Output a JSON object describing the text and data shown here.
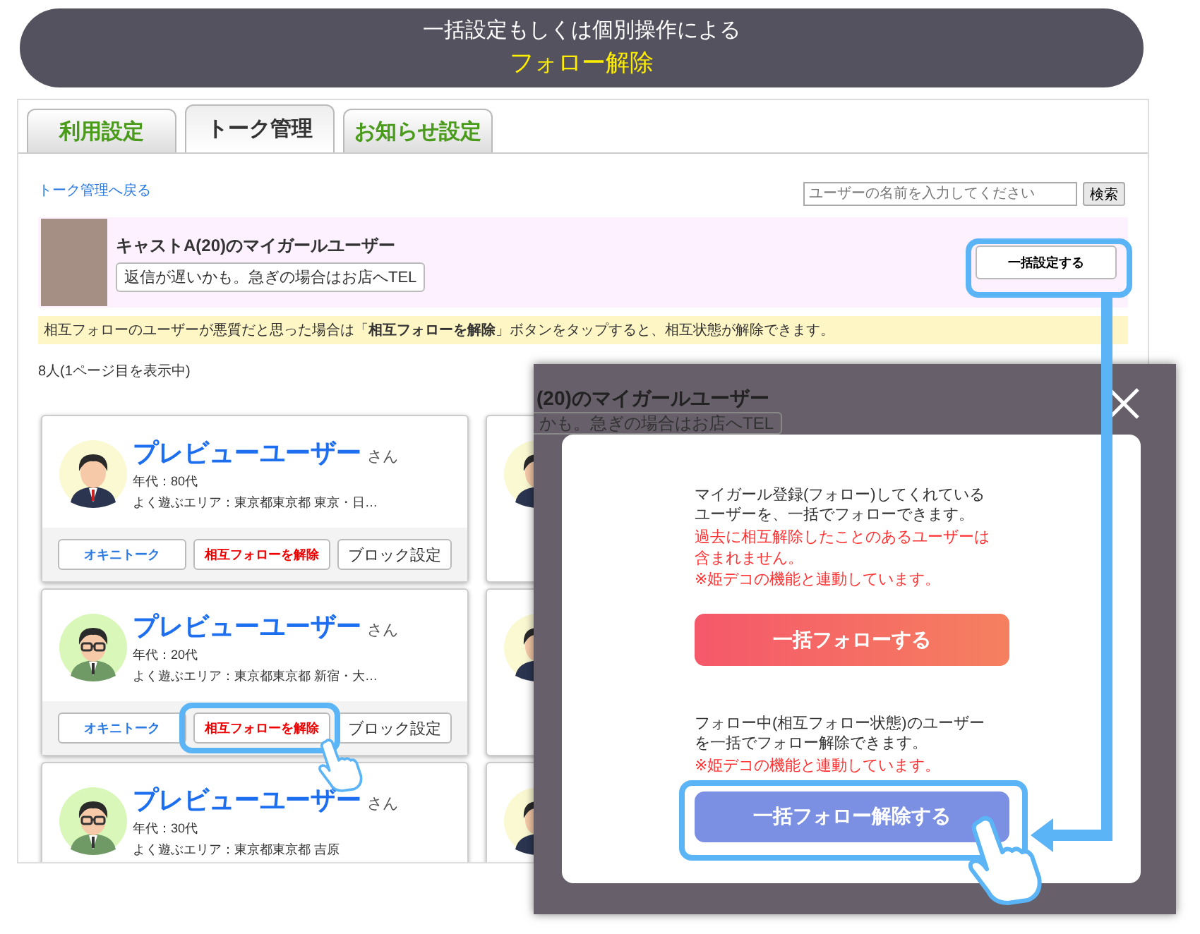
{
  "banner": {
    "line_1": "一括設定もしくは個別操作による",
    "line_2": "フォロー解除"
  },
  "tabs": [
    {
      "label": "利用設定",
      "selected": false
    },
    {
      "label": "トーク管理",
      "selected": true
    },
    {
      "label": "お知らせ設定",
      "selected": false
    }
  ],
  "back_link": "トーク管理へ戻る",
  "search": {
    "placeholder": "ユーザーの名前を入力してください",
    "button": "検索"
  },
  "cast": {
    "title": "キャストA(20)のマイガールユーザー",
    "comment": "返信が遅いかも。急ぎの場合はお店へTEL",
    "button": "一括設定する"
  },
  "notice": "相互フォローのユーザーが悪質だと思った場合は「**相互フォローを解除**」ボタンをタップすると、相互状態が解除できます。",
  "count": "8人(1ページ目を表示中)",
  "users": [
    {
      "kind": "plain",
      "name": "プレビューユーザー",
      "suffix": "さん",
      "age": "年代：80代",
      "area": "よく遊ぶエリア：東京都東京都 東京・日…",
      "buttons": [
        "オキニトーク",
        "相互フォローを解除",
        "ブロック設定"
      ]
    },
    {
      "kind": "glasses",
      "name": "プレビューユーザー",
      "suffix": "さん",
      "age": "年代：20代",
      "area": "よく遊ぶエリア：東京都東京都 新宿・大…",
      "buttons": [
        "オキニトーク",
        "相互フォローを解除",
        "ブロック設定"
      ]
    },
    {
      "kind": "glasses",
      "name": "プレビューユーザー",
      "suffix": "さん",
      "age": "年代：30代",
      "area": "よく遊ぶエリア：東京都東京都 吉原"
    }
  ],
  "modal": {
    "backdrop_title": "(20)のマイガールユーザー",
    "backdrop_comment": "かも。急ぎの場合はお店へTEL",
    "follow_text": [
      "マイガール登録(フォロー)してくれている",
      "ユーザーを、一括でフォローできます。"
    ],
    "follow_note": [
      "過去に相互解除したことのあるユーザーは",
      "含まれません。",
      "※姫デコの機能と連動しています。"
    ],
    "follow_button": "一括フォローする",
    "unfollow_text": [
      "フォロー中(相互フォロー状態)のユーザー",
      "を一括でフォロー解除できます。"
    ],
    "unfollow_note": "※姫デコの機能と連動しています。",
    "unfollow_button": "一括フォロー解除する"
  }
}
